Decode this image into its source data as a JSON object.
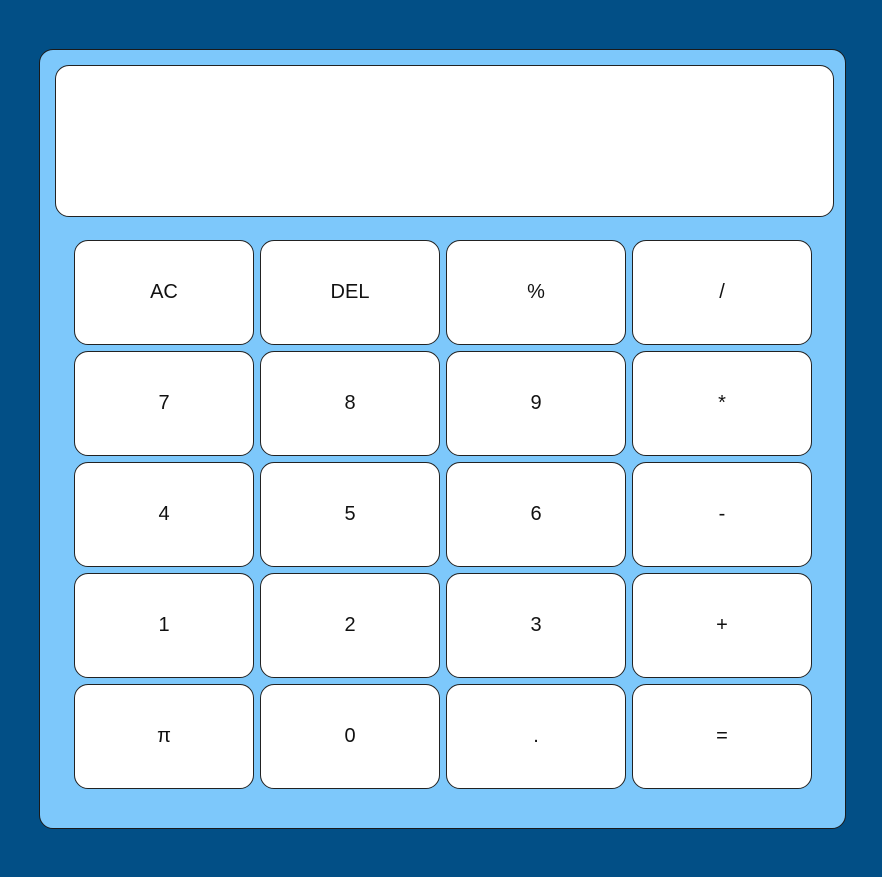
{
  "display": {
    "value": ""
  },
  "keys": [
    {
      "label": "AC"
    },
    {
      "label": "DEL"
    },
    {
      "label": "%"
    },
    {
      "label": "/"
    },
    {
      "label": "7"
    },
    {
      "label": "8"
    },
    {
      "label": "9"
    },
    {
      "label": "*"
    },
    {
      "label": "4"
    },
    {
      "label": "5"
    },
    {
      "label": "6"
    },
    {
      "label": "-"
    },
    {
      "label": "1"
    },
    {
      "label": "2"
    },
    {
      "label": "3"
    },
    {
      "label": "+"
    },
    {
      "label": "π"
    },
    {
      "label": "0"
    },
    {
      "label": "."
    },
    {
      "label": "="
    }
  ],
  "colors": {
    "page_background": "#024f86",
    "calculator_body": "#7dc8fb",
    "key_background": "#ffffff",
    "border": "#222222"
  }
}
